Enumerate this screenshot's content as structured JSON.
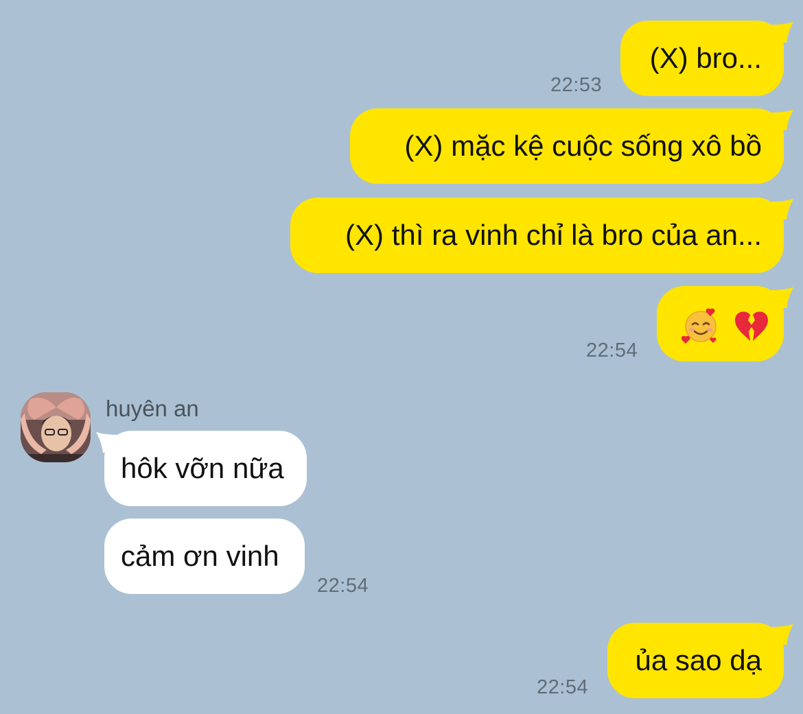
{
  "chat": {
    "contact_name": "huyên an",
    "messages": [
      {
        "id": "m1",
        "from": "me",
        "text": "(X) bro...",
        "time": "22:53"
      },
      {
        "id": "m2",
        "from": "me",
        "text": "(X) mặc kệ cuộc sống xô bồ"
      },
      {
        "id": "m3",
        "from": "me",
        "text": "(X) thì ra vinh chỉ là bro của an..."
      },
      {
        "id": "m4",
        "from": "me",
        "emojis": [
          "smiling-face-with-hearts",
          "broken-heart"
        ],
        "time": "22:54"
      },
      {
        "id": "m5",
        "from": "them",
        "text": "hôk vỡn nữa"
      },
      {
        "id": "m6",
        "from": "them",
        "text": "cảm ơn vinh",
        "time": "22:54"
      },
      {
        "id": "m7",
        "from": "me",
        "text": "ủa sao dạ",
        "time": "22:54"
      }
    ]
  },
  "colors": {
    "background": "#abc1d3",
    "my_bubble": "#ffe500",
    "their_bubble": "#ffffff",
    "timestamp": "#5f6c78"
  }
}
